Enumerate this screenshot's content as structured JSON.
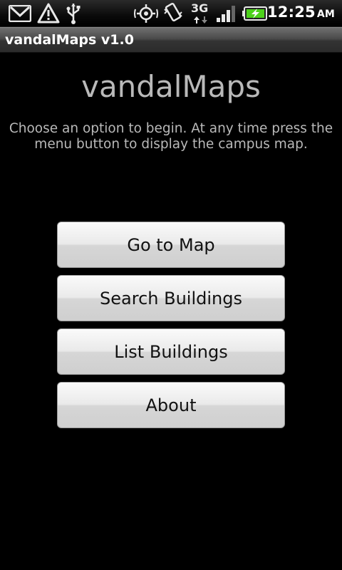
{
  "status_bar": {
    "time": "12:25",
    "ampm": "AM",
    "network": "3G",
    "icons": [
      "gmail-icon",
      "warning-icon",
      "usb-icon",
      "gps-icon",
      "vibrate-icon",
      "network-3g-icon",
      "signal-icon",
      "battery-charging-icon"
    ]
  },
  "title_bar": {
    "title": "vandalMaps v1.0"
  },
  "main": {
    "heading": "vandalMaps",
    "subtitle": "Choose an option to begin. At any time press the menu button to display the campus map.",
    "buttons": [
      {
        "label": "Go to Map"
      },
      {
        "label": "Search Buildings"
      },
      {
        "label": "List Buildings"
      },
      {
        "label": "About"
      }
    ]
  },
  "colors": {
    "background": "#000000",
    "heading_text": "#b9b9b9",
    "button_text": "#111111",
    "battery_charge": "#4cd11a"
  }
}
